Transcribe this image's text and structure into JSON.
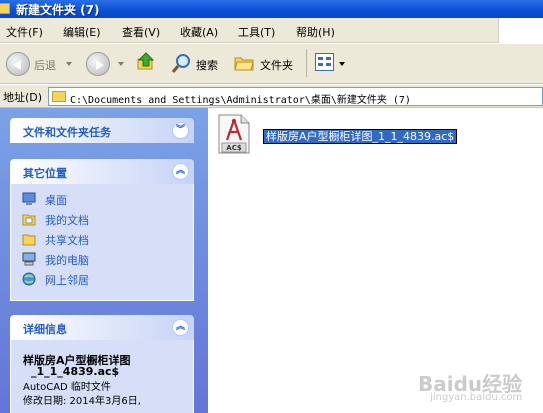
{
  "window": {
    "title": "新建文件夹 (7)"
  },
  "menubar": {
    "items": [
      "文件(F)",
      "编辑(E)",
      "查看(V)",
      "收藏(A)",
      "工具(T)",
      "帮助(H)"
    ]
  },
  "toolbar": {
    "back_label": "后退",
    "search_label": "搜索",
    "folders_label": "文件夹"
  },
  "addressbar": {
    "label": "地址(D)",
    "path": "C:\\Documents and Settings\\Administrator\\桌面\\新建文件夹 (7)"
  },
  "tasks_panel": {
    "title": "文件和文件夹任务",
    "chevron": "︾"
  },
  "places_panel": {
    "title": "其它位置",
    "chevron": "︽",
    "items": [
      {
        "label": "桌面",
        "icon": "desktop-icon"
      },
      {
        "label": "我的文档",
        "icon": "my-documents-icon"
      },
      {
        "label": "共享文档",
        "icon": "shared-folder-icon"
      },
      {
        "label": "我的电脑",
        "icon": "my-computer-icon"
      },
      {
        "label": "网上邻居",
        "icon": "network-icon"
      }
    ]
  },
  "details_panel": {
    "title": "详细信息",
    "chevron": "︽",
    "name_line1": "样版房A户型橱柜详图",
    "name_line2": "_1_1_4839.ac$",
    "type": "AutoCAD 临时文件",
    "modified": "修改日期: 2014年3月6日,"
  },
  "file": {
    "name": "样版房A户型橱柜详图_1_1_4839.ac$",
    "icon_label": "AC$"
  },
  "watermark": {
    "text": "Baidu经验",
    "sub": "jingyan.baidu.com"
  },
  "colors": {
    "titlebar": "#0a4fd4",
    "task_pane": "#7ba2e7",
    "link": "#215dc6",
    "selection": "#316ac5"
  }
}
